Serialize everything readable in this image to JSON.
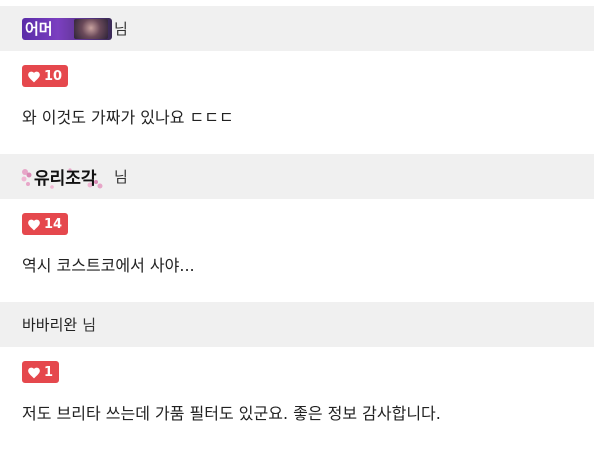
{
  "colors": {
    "header_bg": "#f0f0f0",
    "like_badge_bg": "#e5484d",
    "text": "#222222"
  },
  "comments": [
    {
      "author_badge_text": "어머",
      "author_display_type": "badge-with-photo",
      "honorific": "님",
      "likes": "10",
      "text": "와 이것도 가짜가 있나요 ㄷㄷㄷ"
    },
    {
      "author_image_text": "유리조각",
      "author_display_type": "image-nickname",
      "honorific": "님",
      "likes": "14",
      "text": "역시 코스트코에서 사야..."
    },
    {
      "author": "바바리완",
      "author_display_type": "text",
      "honorific": "님",
      "likes": "1",
      "text": "저도 브리타 쓰는데 가품 필터도 있군요. 좋은 정보 감사합니다."
    }
  ]
}
